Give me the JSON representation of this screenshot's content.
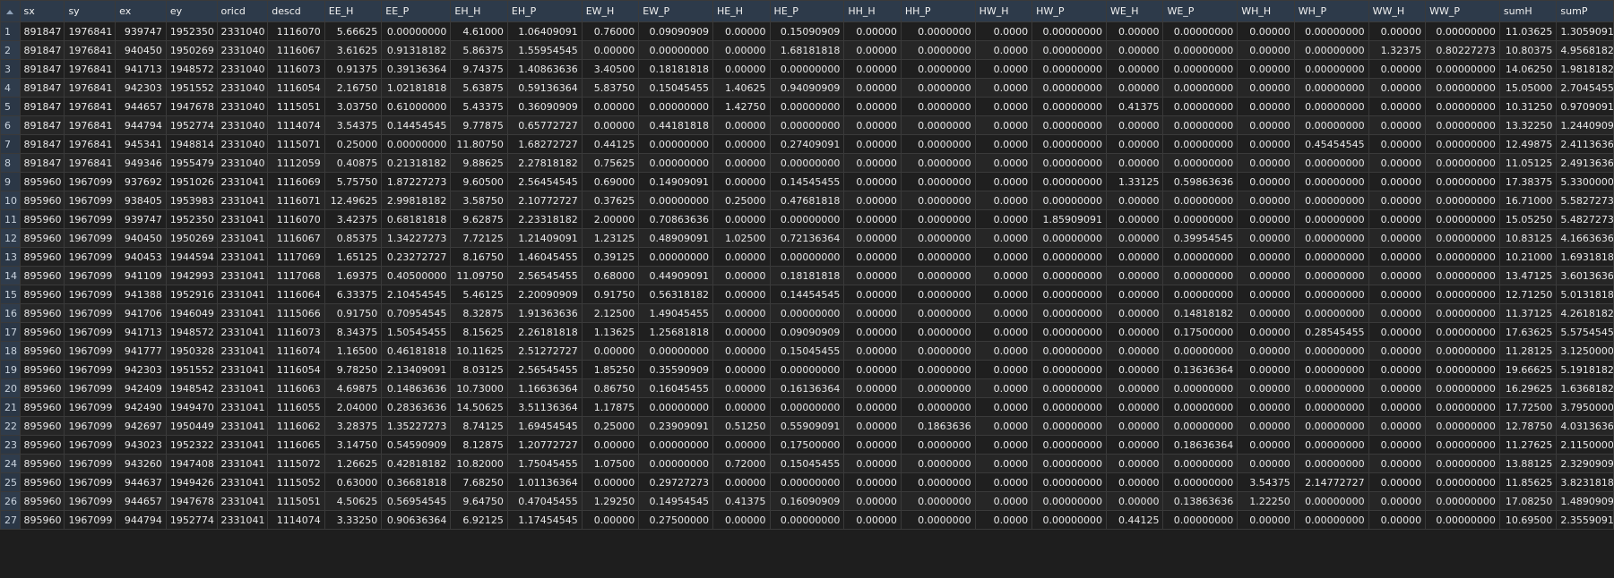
{
  "headers": [
    "sx",
    "sy",
    "ex",
    "ey",
    "oricd",
    "descd",
    "EE_H",
    "EE_P",
    "EH_H",
    "EH_P",
    "EW_H",
    "EW_P",
    "HE_H",
    "HE_P",
    "HH_H",
    "HH_P",
    "HW_H",
    "HW_P",
    "WE_H",
    "WE_P",
    "WH_H",
    "WH_P",
    "WW_H",
    "WW_P",
    "sumH",
    "sumP"
  ],
  "rows": [
    [
      "891847",
      "1976841",
      "939747",
      "1952350",
      "2331040",
      "1116070",
      "5.66625",
      "0.00000000",
      "4.61000",
      "1.06409091",
      "0.76000",
      "0.09090909",
      "0.00000",
      "0.15090909",
      "0.00000",
      "0.0000000",
      "0.0000",
      "0.00000000",
      "0.00000",
      "0.00000000",
      "0.00000",
      "0.00000000",
      "0.00000",
      "0.00000000",
      "11.03625",
      "1.3059091"
    ],
    [
      "891847",
      "1976841",
      "940450",
      "1950269",
      "2331040",
      "1116067",
      "3.61625",
      "0.91318182",
      "5.86375",
      "1.55954545",
      "0.00000",
      "0.00000000",
      "0.00000",
      "1.68181818",
      "0.00000",
      "0.0000000",
      "0.0000",
      "0.00000000",
      "0.00000",
      "0.00000000",
      "0.00000",
      "0.00000000",
      "1.32375",
      "0.80227273",
      "10.80375",
      "4.9568182"
    ],
    [
      "891847",
      "1976841",
      "941713",
      "1948572",
      "2331040",
      "1116073",
      "0.91375",
      "0.39136364",
      "9.74375",
      "1.40863636",
      "3.40500",
      "0.18181818",
      "0.00000",
      "0.00000000",
      "0.00000",
      "0.0000000",
      "0.0000",
      "0.00000000",
      "0.00000",
      "0.00000000",
      "0.00000",
      "0.00000000",
      "0.00000",
      "0.00000000",
      "14.06250",
      "1.9818182"
    ],
    [
      "891847",
      "1976841",
      "942303",
      "1951552",
      "2331040",
      "1116054",
      "2.16750",
      "1.02181818",
      "5.63875",
      "0.59136364",
      "5.83750",
      "0.15045455",
      "1.40625",
      "0.94090909",
      "0.00000",
      "0.0000000",
      "0.0000",
      "0.00000000",
      "0.00000",
      "0.00000000",
      "0.00000",
      "0.00000000",
      "0.00000",
      "0.00000000",
      "15.05000",
      "2.7045455"
    ],
    [
      "891847",
      "1976841",
      "944657",
      "1947678",
      "2331040",
      "1115051",
      "3.03750",
      "0.61000000",
      "5.43375",
      "0.36090909",
      "0.00000",
      "0.00000000",
      "1.42750",
      "0.00000000",
      "0.00000",
      "0.0000000",
      "0.0000",
      "0.00000000",
      "0.41375",
      "0.00000000",
      "0.00000",
      "0.00000000",
      "0.00000",
      "0.00000000",
      "10.31250",
      "0.9709091"
    ],
    [
      "891847",
      "1976841",
      "944794",
      "1952774",
      "2331040",
      "1114074",
      "3.54375",
      "0.14454545",
      "9.77875",
      "0.65772727",
      "0.00000",
      "0.44181818",
      "0.00000",
      "0.00000000",
      "0.00000",
      "0.0000000",
      "0.0000",
      "0.00000000",
      "0.00000",
      "0.00000000",
      "0.00000",
      "0.00000000",
      "0.00000",
      "0.00000000",
      "13.32250",
      "1.2440909"
    ],
    [
      "891847",
      "1976841",
      "945341",
      "1948814",
      "2331040",
      "1115071",
      "0.25000",
      "0.00000000",
      "11.80750",
      "1.68272727",
      "0.44125",
      "0.00000000",
      "0.00000",
      "0.27409091",
      "0.00000",
      "0.0000000",
      "0.0000",
      "0.00000000",
      "0.00000",
      "0.00000000",
      "0.00000",
      "0.45454545",
      "0.00000",
      "0.00000000",
      "12.49875",
      "2.4113636"
    ],
    [
      "891847",
      "1976841",
      "949346",
      "1955479",
      "2331040",
      "1112059",
      "0.40875",
      "0.21318182",
      "9.88625",
      "2.27818182",
      "0.75625",
      "0.00000000",
      "0.00000",
      "0.00000000",
      "0.00000",
      "0.0000000",
      "0.0000",
      "0.00000000",
      "0.00000",
      "0.00000000",
      "0.00000",
      "0.00000000",
      "0.00000",
      "0.00000000",
      "11.05125",
      "2.4913636"
    ],
    [
      "895960",
      "1967099",
      "937692",
      "1951026",
      "2331041",
      "1116069",
      "5.75750",
      "1.87227273",
      "9.60500",
      "2.56454545",
      "0.69000",
      "0.14909091",
      "0.00000",
      "0.14545455",
      "0.00000",
      "0.0000000",
      "0.0000",
      "0.00000000",
      "1.33125",
      "0.59863636",
      "0.00000",
      "0.00000000",
      "0.00000",
      "0.00000000",
      "17.38375",
      "5.3300000"
    ],
    [
      "895960",
      "1967099",
      "938405",
      "1953983",
      "2331041",
      "1116071",
      "12.49625",
      "2.99818182",
      "3.58750",
      "2.10772727",
      "0.37625",
      "0.00000000",
      "0.25000",
      "0.47681818",
      "0.00000",
      "0.0000000",
      "0.0000",
      "0.00000000",
      "0.00000",
      "0.00000000",
      "0.00000",
      "0.00000000",
      "0.00000",
      "0.00000000",
      "16.71000",
      "5.5827273"
    ],
    [
      "895960",
      "1967099",
      "939747",
      "1952350",
      "2331041",
      "1116070",
      "3.42375",
      "0.68181818",
      "9.62875",
      "2.23318182",
      "2.00000",
      "0.70863636",
      "0.00000",
      "0.00000000",
      "0.00000",
      "0.0000000",
      "0.0000",
      "1.85909091",
      "0.00000",
      "0.00000000",
      "0.00000",
      "0.00000000",
      "0.00000",
      "0.00000000",
      "15.05250",
      "5.4827273"
    ],
    [
      "895960",
      "1967099",
      "940450",
      "1950269",
      "2331041",
      "1116067",
      "0.85375",
      "1.34227273",
      "7.72125",
      "1.21409091",
      "1.23125",
      "0.48909091",
      "1.02500",
      "0.72136364",
      "0.00000",
      "0.0000000",
      "0.0000",
      "0.00000000",
      "0.00000",
      "0.39954545",
      "0.00000",
      "0.00000000",
      "0.00000",
      "0.00000000",
      "10.83125",
      "4.1663636"
    ],
    [
      "895960",
      "1967099",
      "940453",
      "1944594",
      "2331041",
      "1117069",
      "1.65125",
      "0.23272727",
      "8.16750",
      "1.46045455",
      "0.39125",
      "0.00000000",
      "0.00000",
      "0.00000000",
      "0.00000",
      "0.0000000",
      "0.0000",
      "0.00000000",
      "0.00000",
      "0.00000000",
      "0.00000",
      "0.00000000",
      "0.00000",
      "0.00000000",
      "10.21000",
      "1.6931818"
    ],
    [
      "895960",
      "1967099",
      "941109",
      "1942993",
      "2331041",
      "1117068",
      "1.69375",
      "0.40500000",
      "11.09750",
      "2.56545455",
      "0.68000",
      "0.44909091",
      "0.00000",
      "0.18181818",
      "0.00000",
      "0.0000000",
      "0.0000",
      "0.00000000",
      "0.00000",
      "0.00000000",
      "0.00000",
      "0.00000000",
      "0.00000",
      "0.00000000",
      "13.47125",
      "3.6013636"
    ],
    [
      "895960",
      "1967099",
      "941388",
      "1952916",
      "2331041",
      "1116064",
      "6.33375",
      "2.10454545",
      "5.46125",
      "2.20090909",
      "0.91750",
      "0.56318182",
      "0.00000",
      "0.14454545",
      "0.00000",
      "0.0000000",
      "0.0000",
      "0.00000000",
      "0.00000",
      "0.00000000",
      "0.00000",
      "0.00000000",
      "0.00000",
      "0.00000000",
      "12.71250",
      "5.0131818"
    ],
    [
      "895960",
      "1967099",
      "941706",
      "1946049",
      "2331041",
      "1115066",
      "0.91750",
      "0.70954545",
      "8.32875",
      "1.91363636",
      "2.12500",
      "1.49045455",
      "0.00000",
      "0.00000000",
      "0.00000",
      "0.0000000",
      "0.0000",
      "0.00000000",
      "0.00000",
      "0.14818182",
      "0.00000",
      "0.00000000",
      "0.00000",
      "0.00000000",
      "11.37125",
      "4.2618182"
    ],
    [
      "895960",
      "1967099",
      "941713",
      "1948572",
      "2331041",
      "1116073",
      "8.34375",
      "1.50545455",
      "8.15625",
      "2.26181818",
      "1.13625",
      "1.25681818",
      "0.00000",
      "0.09090909",
      "0.00000",
      "0.0000000",
      "0.0000",
      "0.00000000",
      "0.00000",
      "0.17500000",
      "0.00000",
      "0.28545455",
      "0.00000",
      "0.00000000",
      "17.63625",
      "5.5754545"
    ],
    [
      "895960",
      "1967099",
      "941777",
      "1950328",
      "2331041",
      "1116074",
      "1.16500",
      "0.46181818",
      "10.11625",
      "2.51272727",
      "0.00000",
      "0.00000000",
      "0.00000",
      "0.15045455",
      "0.00000",
      "0.0000000",
      "0.0000",
      "0.00000000",
      "0.00000",
      "0.00000000",
      "0.00000",
      "0.00000000",
      "0.00000",
      "0.00000000",
      "11.28125",
      "3.1250000"
    ],
    [
      "895960",
      "1967099",
      "942303",
      "1951552",
      "2331041",
      "1116054",
      "9.78250",
      "2.13409091",
      "8.03125",
      "2.56545455",
      "1.85250",
      "0.35590909",
      "0.00000",
      "0.00000000",
      "0.00000",
      "0.0000000",
      "0.0000",
      "0.00000000",
      "0.00000",
      "0.13636364",
      "0.00000",
      "0.00000000",
      "0.00000",
      "0.00000000",
      "19.66625",
      "5.1918182"
    ],
    [
      "895960",
      "1967099",
      "942409",
      "1948542",
      "2331041",
      "1116063",
      "4.69875",
      "0.14863636",
      "10.73000",
      "1.16636364",
      "0.86750",
      "0.16045455",
      "0.00000",
      "0.16136364",
      "0.00000",
      "0.0000000",
      "0.0000",
      "0.00000000",
      "0.00000",
      "0.00000000",
      "0.00000",
      "0.00000000",
      "0.00000",
      "0.00000000",
      "16.29625",
      "1.6368182"
    ],
    [
      "895960",
      "1967099",
      "942490",
      "1949470",
      "2331041",
      "1116055",
      "2.04000",
      "0.28363636",
      "14.50625",
      "3.51136364",
      "1.17875",
      "0.00000000",
      "0.00000",
      "0.00000000",
      "0.00000",
      "0.0000000",
      "0.0000",
      "0.00000000",
      "0.00000",
      "0.00000000",
      "0.00000",
      "0.00000000",
      "0.00000",
      "0.00000000",
      "17.72500",
      "3.7950000"
    ],
    [
      "895960",
      "1967099",
      "942697",
      "1950449",
      "2331041",
      "1116062",
      "3.28375",
      "1.35227273",
      "8.74125",
      "1.69454545",
      "0.25000",
      "0.23909091",
      "0.51250",
      "0.55909091",
      "0.00000",
      "0.1863636",
      "0.0000",
      "0.00000000",
      "0.00000",
      "0.00000000",
      "0.00000",
      "0.00000000",
      "0.00000",
      "0.00000000",
      "12.78750",
      "4.0313636"
    ],
    [
      "895960",
      "1967099",
      "943023",
      "1952322",
      "2331041",
      "1116065",
      "3.14750",
      "0.54590909",
      "8.12875",
      "1.20772727",
      "0.00000",
      "0.00000000",
      "0.00000",
      "0.17500000",
      "0.00000",
      "0.0000000",
      "0.0000",
      "0.00000000",
      "0.00000",
      "0.18636364",
      "0.00000",
      "0.00000000",
      "0.00000",
      "0.00000000",
      "11.27625",
      "2.1150000"
    ],
    [
      "895960",
      "1967099",
      "943260",
      "1947408",
      "2331041",
      "1115072",
      "1.26625",
      "0.42818182",
      "10.82000",
      "1.75045455",
      "1.07500",
      "0.00000000",
      "0.72000",
      "0.15045455",
      "0.00000",
      "0.0000000",
      "0.0000",
      "0.00000000",
      "0.00000",
      "0.00000000",
      "0.00000",
      "0.00000000",
      "0.00000",
      "0.00000000",
      "13.88125",
      "2.3290909"
    ],
    [
      "895960",
      "1967099",
      "944637",
      "1949426",
      "2331041",
      "1115052",
      "0.63000",
      "0.36681818",
      "7.68250",
      "1.01136364",
      "0.00000",
      "0.29727273",
      "0.00000",
      "0.00000000",
      "0.00000",
      "0.0000000",
      "0.0000",
      "0.00000000",
      "0.00000",
      "0.00000000",
      "3.54375",
      "2.14772727",
      "0.00000",
      "0.00000000",
      "11.85625",
      "3.8231818"
    ],
    [
      "895960",
      "1967099",
      "944657",
      "1947678",
      "2331041",
      "1115051",
      "4.50625",
      "0.56954545",
      "9.64750",
      "0.47045455",
      "1.29250",
      "0.14954545",
      "0.41375",
      "0.16090909",
      "0.00000",
      "0.0000000",
      "0.0000",
      "0.00000000",
      "0.00000",
      "0.13863636",
      "1.22250",
      "0.00000000",
      "0.00000",
      "0.00000000",
      "17.08250",
      "1.4890909"
    ],
    [
      "895960",
      "1967099",
      "944794",
      "1952774",
      "2331041",
      "1114074",
      "3.33250",
      "0.90636364",
      "6.92125",
      "1.17454545",
      "0.00000",
      "0.27500000",
      "0.00000",
      "0.00000000",
      "0.00000",
      "0.0000000",
      "0.0000",
      "0.00000000",
      "0.44125",
      "0.00000000",
      "0.00000",
      "0.00000000",
      "0.00000",
      "0.00000000",
      "10.69500",
      "2.3559091"
    ]
  ]
}
